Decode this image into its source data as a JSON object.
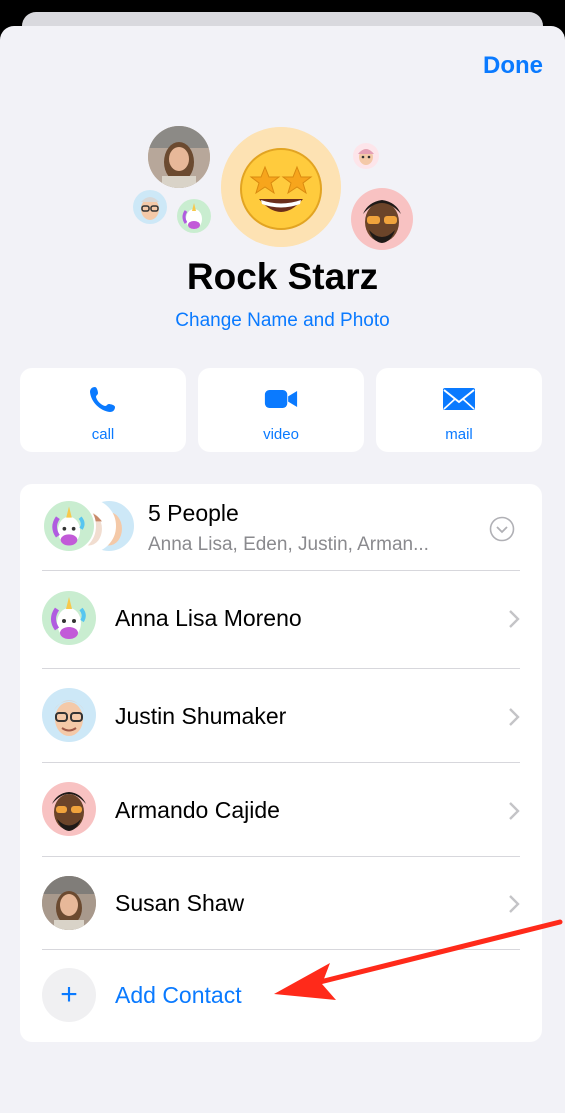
{
  "header": {
    "done_label": "Done"
  },
  "group": {
    "name": "Rock Starz",
    "change_link": "Change Name and Photo"
  },
  "actions": [
    {
      "label": "call",
      "icon": "phone-icon"
    },
    {
      "label": "video",
      "icon": "video-icon"
    },
    {
      "label": "mail",
      "icon": "mail-icon"
    }
  ],
  "members_summary": {
    "title": "5 People",
    "subtitle": "Anna Lisa, Eden, Justin, Arman..."
  },
  "contacts": [
    {
      "name": "Anna Lisa Moreno",
      "avatar": "unicorn-memoji"
    },
    {
      "name": "Justin Shumaker",
      "avatar": "glasses-memoji"
    },
    {
      "name": "Armando Cajide",
      "avatar": "sunglasses-memoji"
    },
    {
      "name": "Susan Shaw",
      "avatar": "photo"
    }
  ],
  "add_contact": {
    "label": "Add Contact",
    "icon": "plus-icon"
  },
  "colors": {
    "accent": "#0a7aff",
    "background": "#f2f2f7",
    "annotation_arrow": "#ff2a1a"
  }
}
